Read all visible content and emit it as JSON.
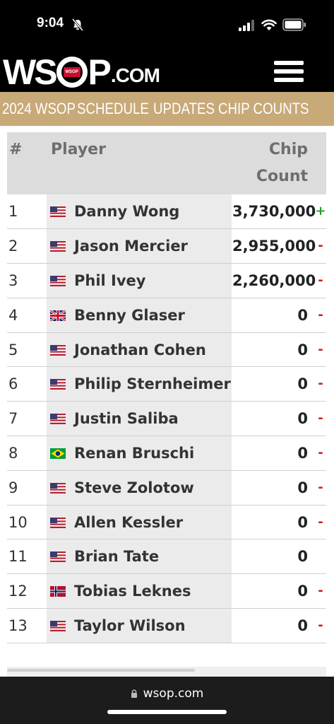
{
  "status_bar": {
    "time": "9:04"
  },
  "header": {
    "logo_text_left": "WS",
    "logo_text_right": "P",
    "logo_suffix": ".COM",
    "logo_badge": "WSOP"
  },
  "nav": {
    "items": [
      "2024 WSOP",
      "SCHEDULE",
      "UPDATES",
      "CHIP COUNTS"
    ]
  },
  "table": {
    "headers": {
      "num": "#",
      "player": "Player",
      "chip": "Chip Count"
    },
    "rows": [
      {
        "rank": "1",
        "flag": "usa",
        "player": "Danny Wong",
        "chips": "3,730,000",
        "trend": "+"
      },
      {
        "rank": "2",
        "flag": "usa",
        "player": "Jason Mercier",
        "chips": "2,955,000",
        "trend": "-"
      },
      {
        "rank": "3",
        "flag": "usa",
        "player": "Phil Ivey",
        "chips": "2,260,000",
        "trend": "-"
      },
      {
        "rank": "4",
        "flag": "uk",
        "player": "Benny Glaser",
        "chips": "0",
        "trend": "-"
      },
      {
        "rank": "5",
        "flag": "usa",
        "player": "Jonathan Cohen",
        "chips": "0",
        "trend": "-"
      },
      {
        "rank": "6",
        "flag": "usa",
        "player": "Philip Sternheimer",
        "chips": "0",
        "trend": "-"
      },
      {
        "rank": "7",
        "flag": "usa",
        "player": "Justin Saliba",
        "chips": "0",
        "trend": "-"
      },
      {
        "rank": "8",
        "flag": "brazil",
        "player": "Renan Bruschi",
        "chips": "0",
        "trend": "-"
      },
      {
        "rank": "9",
        "flag": "usa",
        "player": "Steve Zolotow",
        "chips": "0",
        "trend": "-"
      },
      {
        "rank": "10",
        "flag": "usa",
        "player": "Allen Kessler",
        "chips": "0",
        "trend": "-"
      },
      {
        "rank": "11",
        "flag": "usa",
        "player": "Brian Tate",
        "chips": "0",
        "trend": ""
      },
      {
        "rank": "12",
        "flag": "norway",
        "player": "Tobias Leknes",
        "chips": "0",
        "trend": "-"
      },
      {
        "rank": "13",
        "flag": "usa",
        "player": "Taylor Wilson",
        "chips": "0",
        "trend": "-"
      }
    ]
  },
  "browser": {
    "url": "wsop.com"
  },
  "colors": {
    "gold": "#c8a978",
    "up": "#2a9d2a",
    "down": "#d11a1a"
  }
}
